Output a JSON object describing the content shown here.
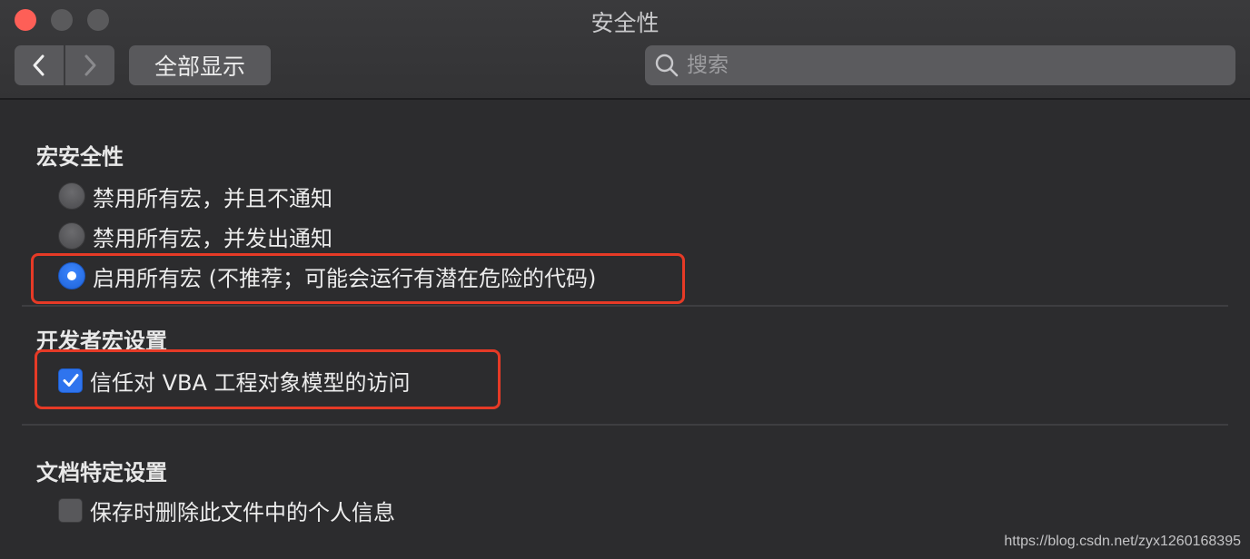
{
  "window": {
    "title": "安全性"
  },
  "toolbar": {
    "show_all_label": "全部显示",
    "search_placeholder": "搜索"
  },
  "macro_security": {
    "title": "宏安全性",
    "options": [
      {
        "label": "禁用所有宏，并且不通知",
        "selected": false
      },
      {
        "label": "禁用所有宏，并发出通知",
        "selected": false
      },
      {
        "label": "启用所有宏 (不推荐；可能会运行有潜在危险的代码)",
        "selected": true
      }
    ]
  },
  "developer_macro": {
    "title": "开发者宏设置",
    "trust_vba": {
      "label": "信任对 VBA 工程对象模型的访问",
      "checked": true
    }
  },
  "document_settings": {
    "title": "文档特定设置",
    "remove_personal": {
      "label": "保存时删除此文件中的个人信息",
      "checked": false
    }
  },
  "watermark": "https://blog.csdn.net/zyx1260168395",
  "colors": {
    "accent": "#2f74ee",
    "highlight": "#e63a26",
    "close": "#fe5f57"
  },
  "icons": [
    "close-icon",
    "minimize-icon",
    "zoom-icon",
    "chevron-left-icon",
    "chevron-right-icon",
    "search-icon",
    "checkmark-icon"
  ]
}
